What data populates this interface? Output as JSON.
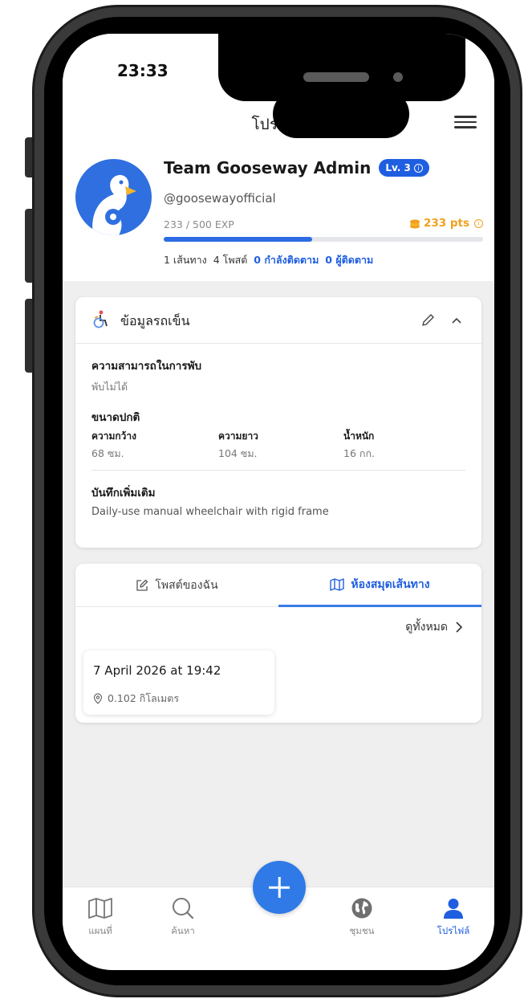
{
  "status_bar": {
    "time": "23:33",
    "signal": "....."
  },
  "header": {
    "title": "โปรไฟล์"
  },
  "profile": {
    "name": "Team Gooseway Admin",
    "level": "Lv. 3",
    "level_info": "i",
    "handle": "@goosewayofficial",
    "exp_text": "233 / 500 EXP",
    "exp_progress": 0.466,
    "points": "233 pts",
    "points_info": "i",
    "stats": {
      "routes": "1 เส้นทาง",
      "posts": "4 โพสต์",
      "following": "0 กำลังติดตาม",
      "followers": "0 ผู้ติดตาม"
    }
  },
  "wheelchair_card": {
    "title": "ข้อมูลรถเข็น",
    "fold_label": "ความสามารถในการพับ",
    "fold_value": "พับไม่ได้",
    "size_label": "ขนาดปกติ",
    "width_label": "ความกว้าง",
    "width_value": "68 ซม.",
    "length_label": "ความยาว",
    "length_value": "104 ซม.",
    "weight_label": "น้ำหนัก",
    "weight_value": "16 กก.",
    "notes_label": "บันทึกเพิ่มเติม",
    "notes_value": "Daily-use manual wheelchair with rigid frame"
  },
  "routes_card": {
    "tabs": [
      {
        "label": "โพสต์ของฉัน",
        "active": false
      },
      {
        "label": "ห้องสมุดเส้นทาง",
        "active": true
      }
    ],
    "see_all": "ดูทั้งหมด",
    "items": [
      {
        "date": "7 April 2026 at 19:42",
        "distance": "0.102 กิโลเมตร"
      }
    ]
  },
  "bottom_nav": {
    "items": [
      {
        "label": "แผนที่",
        "icon": "map-icon"
      },
      {
        "label": "ค้นหา",
        "icon": "search-icon"
      },
      {
        "label": "ชุมชน",
        "icon": "globe-icon"
      },
      {
        "label": "โปรไฟล์",
        "icon": "user-icon",
        "active": true
      }
    ]
  },
  "colors": {
    "primary": "#1f5ee0",
    "accent_points": "#f0a01e",
    "background": "#efefef"
  }
}
